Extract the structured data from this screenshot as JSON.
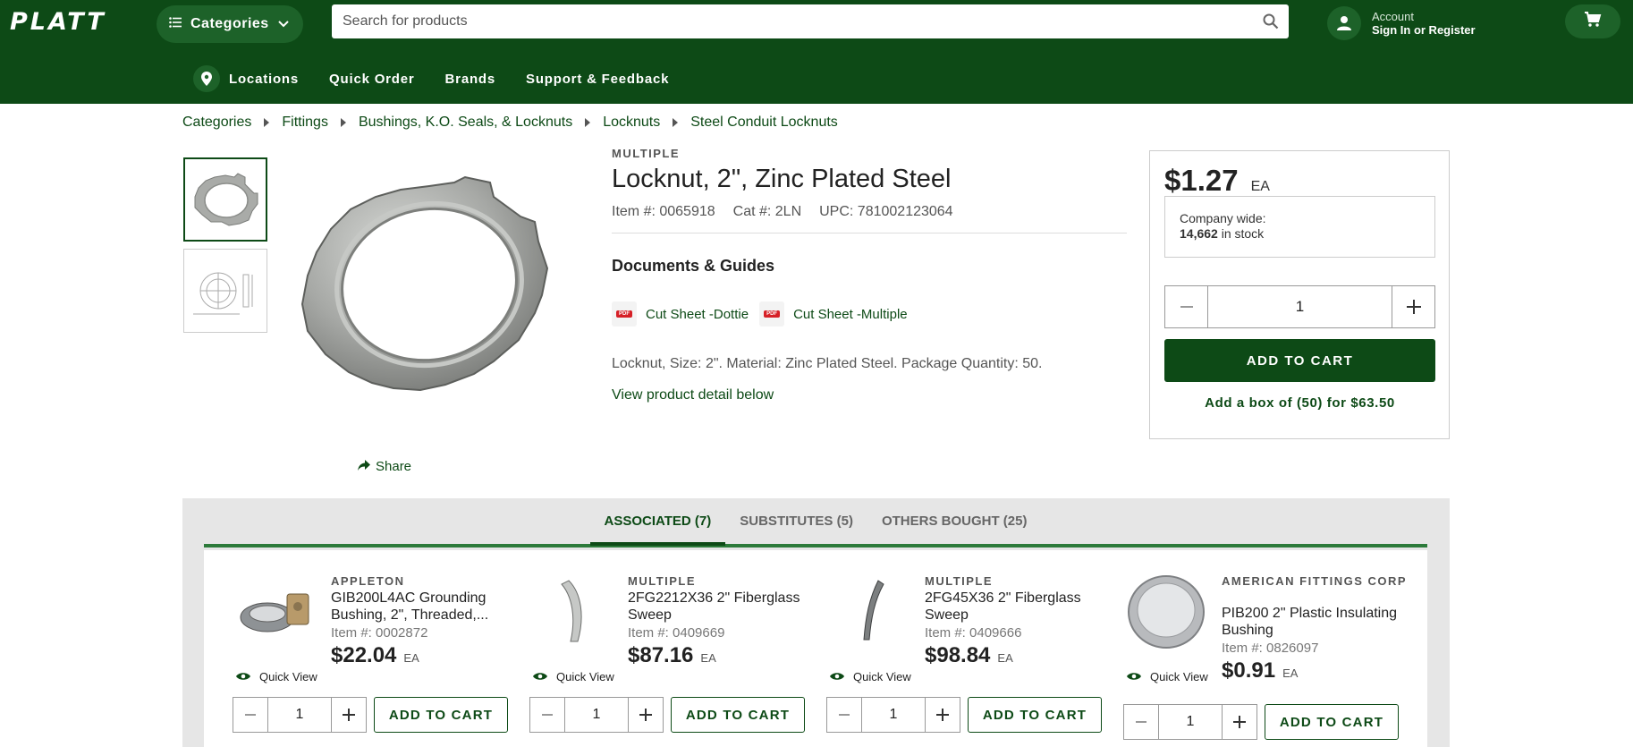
{
  "header": {
    "logo": "PLATT",
    "categories_label": "Categories",
    "search_placeholder": "Search for products",
    "account_label": "Account",
    "account_action": "Sign In or Register"
  },
  "nav": {
    "items": [
      "Locations",
      "Quick Order",
      "Brands",
      "Support & Feedback"
    ]
  },
  "breadcrumb": [
    "Categories",
    "Fittings",
    "Bushings, K.O. Seals, & Locknuts",
    "Locknuts",
    "Steel Conduit Locknuts"
  ],
  "product": {
    "brand": "MULTIPLE",
    "title": "Locknut, 2\", Zinc Plated Steel",
    "item_no": "Item #: 0065918",
    "cat_no": "Cat #: 2LN",
    "upc": "UPC: 781002123064",
    "docs_heading": "Documents & Guides",
    "docs": [
      "Cut Sheet -Dottie",
      "Cut Sheet -Multiple"
    ],
    "pdf_badge": "PDF",
    "description": "Locknut, Size: 2\". Material: Zinc Plated Steel. Package Quantity: 50.",
    "view_detail": "View product detail below",
    "share": "Share"
  },
  "buybox": {
    "price": "$1.27",
    "uom": "EA",
    "company_wide": "Company wide:",
    "stock_count": "14,662",
    "stock_suffix": " in stock",
    "quantity": "1",
    "add_to_cart": "ADD TO CART",
    "box_offer": "Add a box of (50) for $63.50"
  },
  "tabs": [
    "ASSOCIATED (7)",
    "SUBSTITUTES (5)",
    "OTHERS BOUGHT (25)"
  ],
  "active_tab": 0,
  "cards": [
    {
      "brand": "APPLETON",
      "name": "GIB200L4AC Grounding Bushing, 2\", Threaded,...",
      "item": "Item #: 0002872",
      "price": "$22.04",
      "uom": "EA",
      "quick_view": "Quick View",
      "qty": "1",
      "add": "ADD TO CART"
    },
    {
      "brand": "MULTIPLE",
      "name": "2FG2212X36 2\" Fiberglass Sweep",
      "item": "Item #: 0409669",
      "price": "$87.16",
      "uom": "EA",
      "quick_view": "Quick View",
      "qty": "1",
      "add": "ADD TO CART"
    },
    {
      "brand": "MULTIPLE",
      "name": "2FG45X36 2\" Fiberglass Sweep",
      "item": "Item #: 0409666",
      "price": "$98.84",
      "uom": "EA",
      "quick_view": "Quick View",
      "qty": "1",
      "add": "ADD TO CART"
    },
    {
      "brand": "AMERICAN FITTINGS CORP",
      "name": "PIB200 2\" Plastic Insulating Bushing",
      "item": "Item #: 0826097",
      "price": "$0.91",
      "uom": "EA",
      "quick_view": "Quick View",
      "qty": "1",
      "add": "ADD TO CART"
    }
  ],
  "colors": {
    "brand_green": "#0d4a16",
    "accent_green": "#1d6229"
  }
}
